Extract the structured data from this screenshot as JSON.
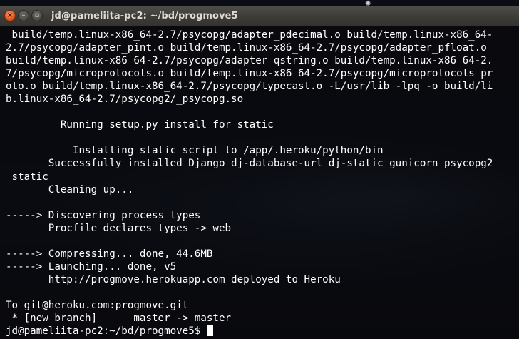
{
  "window": {
    "title": "jd@pameliita-pc2: ~/bd/progmove5",
    "close_glyph": "×",
    "min_glyph": "–",
    "max_glyph": "▫"
  },
  "terminal": {
    "lines": [
      " build/temp.linux-x86_64-2.7/psycopg/adapter_pdecimal.o build/temp.linux-x86_64-",
      "2.7/psycopg/adapter_pint.o build/temp.linux-x86_64-2.7/psycopg/adapter_pfloat.o",
      "build/temp.linux-x86_64-2.7/psycopg/adapter_qstring.o build/temp.linux-x86_64-2.",
      "7/psycopg/microprotocols.o build/temp.linux-x86_64-2.7/psycopg/microprotocols_pr",
      "oto.o build/temp.linux-x86_64-2.7/psycopg/typecast.o -L/usr/lib -lpq -o build/li",
      "b.linux-x86_64-2.7/psycopg2/_psycopg.so",
      "",
      "         Running setup.py install for static",
      "",
      "           Installing static script to /app/.heroku/python/bin",
      "       Successfully installed Django dj-database-url dj-static gunicorn psycopg2",
      " static",
      "       Cleaning up...",
      "",
      "-----> Discovering process types",
      "       Procfile declares types -> web",
      "",
      "-----> Compressing... done, 44.6MB",
      "-----> Launching... done, v5",
      "       http://progmove.herokuapp.com deployed to Heroku",
      "",
      "To git@heroku.com:progmove.git",
      " * [new branch]      master -> master"
    ],
    "prompt": "jd@pameliita-pc2:~/bd/progmove5$ ",
    "colors": {
      "text": "#ffffff",
      "background": "#08080c",
      "titlebar": "#3d3c38",
      "close_button": "#e45b24"
    }
  }
}
